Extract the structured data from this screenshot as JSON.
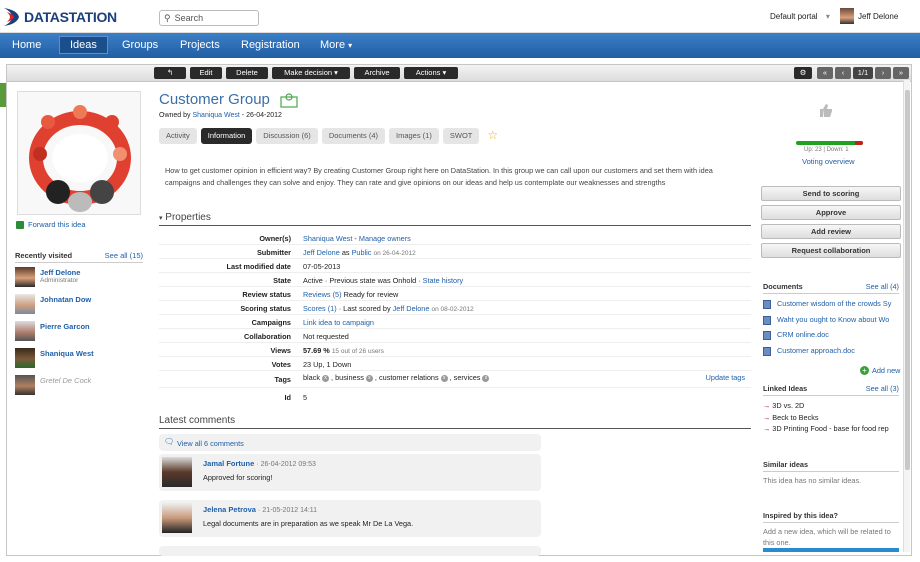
{
  "header": {
    "logo": "DATASTATION",
    "search_placeholder": "Search",
    "portal": "Default portal",
    "user": "Jeff Delone"
  },
  "nav": [
    "Home",
    "Ideas",
    "Groups",
    "Projects",
    "Registration",
    "More"
  ],
  "toolbar": {
    "back": "↰",
    "edit": "Edit",
    "delete": "Delete",
    "make_decision": "Make decision",
    "archive": "Archive",
    "actions": "Actions",
    "pager": "1/1"
  },
  "idea": {
    "title": "Customer Group",
    "owned_prefix": "Owned by",
    "owner": "Shaniqua West",
    "date": "26-04-2012",
    "tabs": [
      "Activity",
      "Information",
      "Discussion (6)",
      "Documents (4)",
      "Images (1)",
      "SWOT"
    ],
    "description": "How to get customer opinion in efficient way? By creating Customer Group right here on DataStation. In this group we can call upon our customers and set them with idea campaigns and challenges they can solve and enjoy. They can rate and give opinions on our ideas and help us contemplate our weaknesses and strengths"
  },
  "left": {
    "forward": "Forward this idea",
    "recent_title": "Recently visited",
    "see_all": "See all (15)",
    "recent": [
      {
        "name": "Jeff Delone",
        "role": "Administrator"
      },
      {
        "name": "Johnatan Dow",
        "role": ""
      },
      {
        "name": "Pierre Garcon",
        "role": ""
      },
      {
        "name": "Shaniqua West",
        "role": ""
      },
      {
        "name": "Gretel De Cock",
        "role": ""
      }
    ]
  },
  "properties": {
    "title": "Properties",
    "owners_k": "Owner(s)",
    "owners_v": "Shaniqua West",
    "manage": "Manage owners",
    "submitter_k": "Submitter",
    "submitter_v": "Jeff Delone",
    "as": "as",
    "public": "Public",
    "submit_date": "on 26-04-2012",
    "modified_k": "Last modified date",
    "modified_v": "07-05-2013",
    "state_k": "State",
    "state_v": "Active · Previous state was Onhold ·",
    "state_hist": "State history",
    "review_k": "Review status",
    "review_link": "Reviews (5)",
    "review_v": "Ready for review",
    "scoring_k": "Scoring status",
    "scoring_link": "Scores (1)",
    "scoring_mid": "· Last scored by",
    "scoring_user": "Jeff Delone",
    "scoring_date": "on 08-02-2012",
    "campaigns_k": "Campaigns",
    "campaigns_v": "Link idea to campaign",
    "collab_k": "Collaboration",
    "collab_v": "Not requested",
    "views_k": "Views",
    "views_v": "57.69 %",
    "views_small": "15 out of 26 users",
    "votes_k": "Votes",
    "votes_v": "23 Up, 1 Down",
    "tags_k": "Tags",
    "tags": [
      "black",
      "business",
      "customer relations",
      "services"
    ],
    "update_tags": "Update tags",
    "id_k": "Id",
    "id_v": "5"
  },
  "comments": {
    "title": "Latest comments",
    "view_all": "View all 6 comments",
    "items": [
      {
        "name": "Jamal Fortune",
        "date": "· 26-04-2012 09:53",
        "text": "Approved for scoring!"
      },
      {
        "name": "Jelena Petrova",
        "date": "· 21-05-2012 14:11",
        "text": "Legal documents are in preparation as we speak Mr De La Vega."
      }
    ]
  },
  "right": {
    "vote_text": "Up: 23 | Down: 1",
    "voting_overview": "Voting overview",
    "buttons": [
      "Send to scoring",
      "Approve",
      "Add review",
      "Request collaboration"
    ],
    "documents_title": "Documents",
    "documents_all": "See all (4)",
    "documents": [
      "Customer wisdom of the crowds Sy",
      "Waht you ought to Know about Wo",
      "CRM online.doc",
      "Customer approach.doc"
    ],
    "add_new": "Add new",
    "linked_title": "Linked Ideas",
    "linked_all": "See all (3)",
    "linked": [
      "3D vs. 2D",
      "Beck to Becks",
      "3D Printing Food - base for food rep"
    ],
    "similar_title": "Similar ideas",
    "similar_text": "This idea has no similar ideas.",
    "inspired_title": "Inspired by this idea?",
    "inspired_text": "Add a new idea, which will be related to this one."
  },
  "colors": {
    "brand": "#1b3f7d",
    "nav": "#2868b0",
    "link": "#1f5fa8"
  }
}
